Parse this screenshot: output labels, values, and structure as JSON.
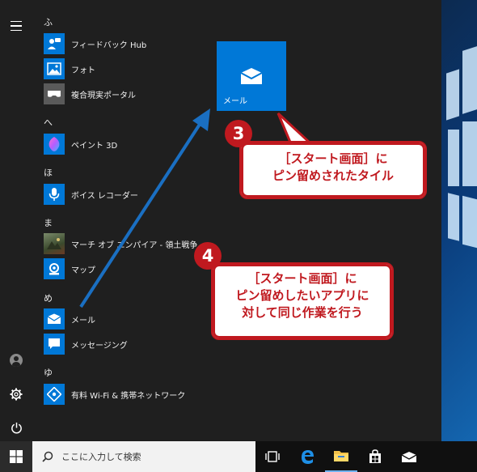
{
  "start_menu": {
    "groups": [
      {
        "letter": "ふ",
        "apps": [
          {
            "label": "フィードバック Hub",
            "icon": "feedback-hub-icon"
          },
          {
            "label": "フォト",
            "icon": "photos-icon"
          },
          {
            "label": "複合現実ポータル",
            "icon": "mixed-reality-portal-icon"
          }
        ]
      },
      {
        "letter": "へ",
        "apps": [
          {
            "label": "ペイント 3D",
            "icon": "paint-3d-icon"
          }
        ]
      },
      {
        "letter": "ほ",
        "apps": [
          {
            "label": "ボイス レコーダー",
            "icon": "voice-recorder-icon"
          }
        ]
      },
      {
        "letter": "ま",
        "apps": [
          {
            "label": "マーチ オブ エンパイア - 領土戦争",
            "icon": "march-of-empires-icon"
          },
          {
            "label": "マップ",
            "icon": "maps-icon"
          }
        ]
      },
      {
        "letter": "め",
        "apps": [
          {
            "label": "メール",
            "icon": "mail-icon"
          },
          {
            "label": "メッセージング",
            "icon": "messaging-icon"
          }
        ]
      },
      {
        "letter": "ゆ",
        "apps": [
          {
            "label": "有料 Wi-Fi & 携帯ネットワーク",
            "icon": "paid-wifi-icon"
          }
        ]
      }
    ],
    "pinned_tile": {
      "label": "メール",
      "icon": "mail-icon"
    }
  },
  "taskbar": {
    "search_placeholder": "ここに入力して検索"
  },
  "callouts": [
    {
      "number": "3",
      "lines": [
        "［スタート画面］に",
        "ピン留めされたタイル"
      ]
    },
    {
      "number": "4",
      "lines": [
        "［スタート画面］に",
        "ピン留めしたいアプリに",
        "対して同じ作業を行う"
      ]
    }
  ],
  "colors": {
    "accent": "#0078d7",
    "callout_red": "#c0191f",
    "menu_bg": "#1f1f1f"
  }
}
